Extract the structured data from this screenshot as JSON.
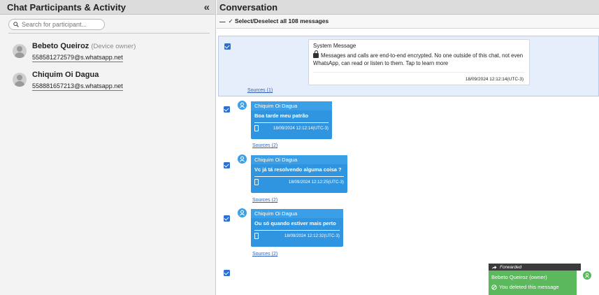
{
  "left_panel": {
    "title": "Chat Participants & Activity",
    "collapse_symbol": "«",
    "search_placeholder": "Search for participant...",
    "participants": [
      {
        "name": "Bebeto Queiroz",
        "tag": "(Device owner)",
        "id": "558581272579@s.whatsapp.net"
      },
      {
        "name": "Chiquim Oi Dagua",
        "tag": "",
        "id": "558881657213@s.whatsapp.net"
      }
    ]
  },
  "conversation": {
    "title": "Conversation",
    "select_dash": "—",
    "select_label": "✓ Select/Deselect all 108 messages",
    "system_message": {
      "title": "System Message",
      "body": "Messages and calls are end-to-end encrypted. No one outside of this chat, not even WhatsApp, can read or listen to them. Tap to learn more",
      "timestamp": "18/09/2024 12:12:14(UTC-3)",
      "sources": "Sources (1)"
    },
    "messages": [
      {
        "sender": "Chiquim Oi Dagua",
        "text": "Boa tarde meu patrão",
        "timestamp": "18/09/2024 12:12:14(UTC-3)",
        "sources": "Sources (2)"
      },
      {
        "sender": "Chiquim Oi Dagua",
        "text": "Vc já tá resolvendo alguma coisa ?",
        "timestamp": "18/09/2024 12:12:25(UTC-3)",
        "sources": "Sources (2)"
      },
      {
        "sender": "Chiquim Oi Dagua",
        "text": "Ou só quando estiver mais perto",
        "timestamp": "18/09/2024 12:12:32(UTC-3)",
        "sources": "Sources (2)"
      }
    ],
    "owner_message": {
      "forwarded_label": "Forwarded",
      "sender": "Bebeto Queiroz (owner)",
      "text": "You deleted this message"
    }
  },
  "colors": {
    "incoming_bubble": "#2f95e0",
    "outgoing_bubble": "#5cb85c",
    "checkbox": "#2f6fd1",
    "system_row_bg": "#e6eefb"
  }
}
